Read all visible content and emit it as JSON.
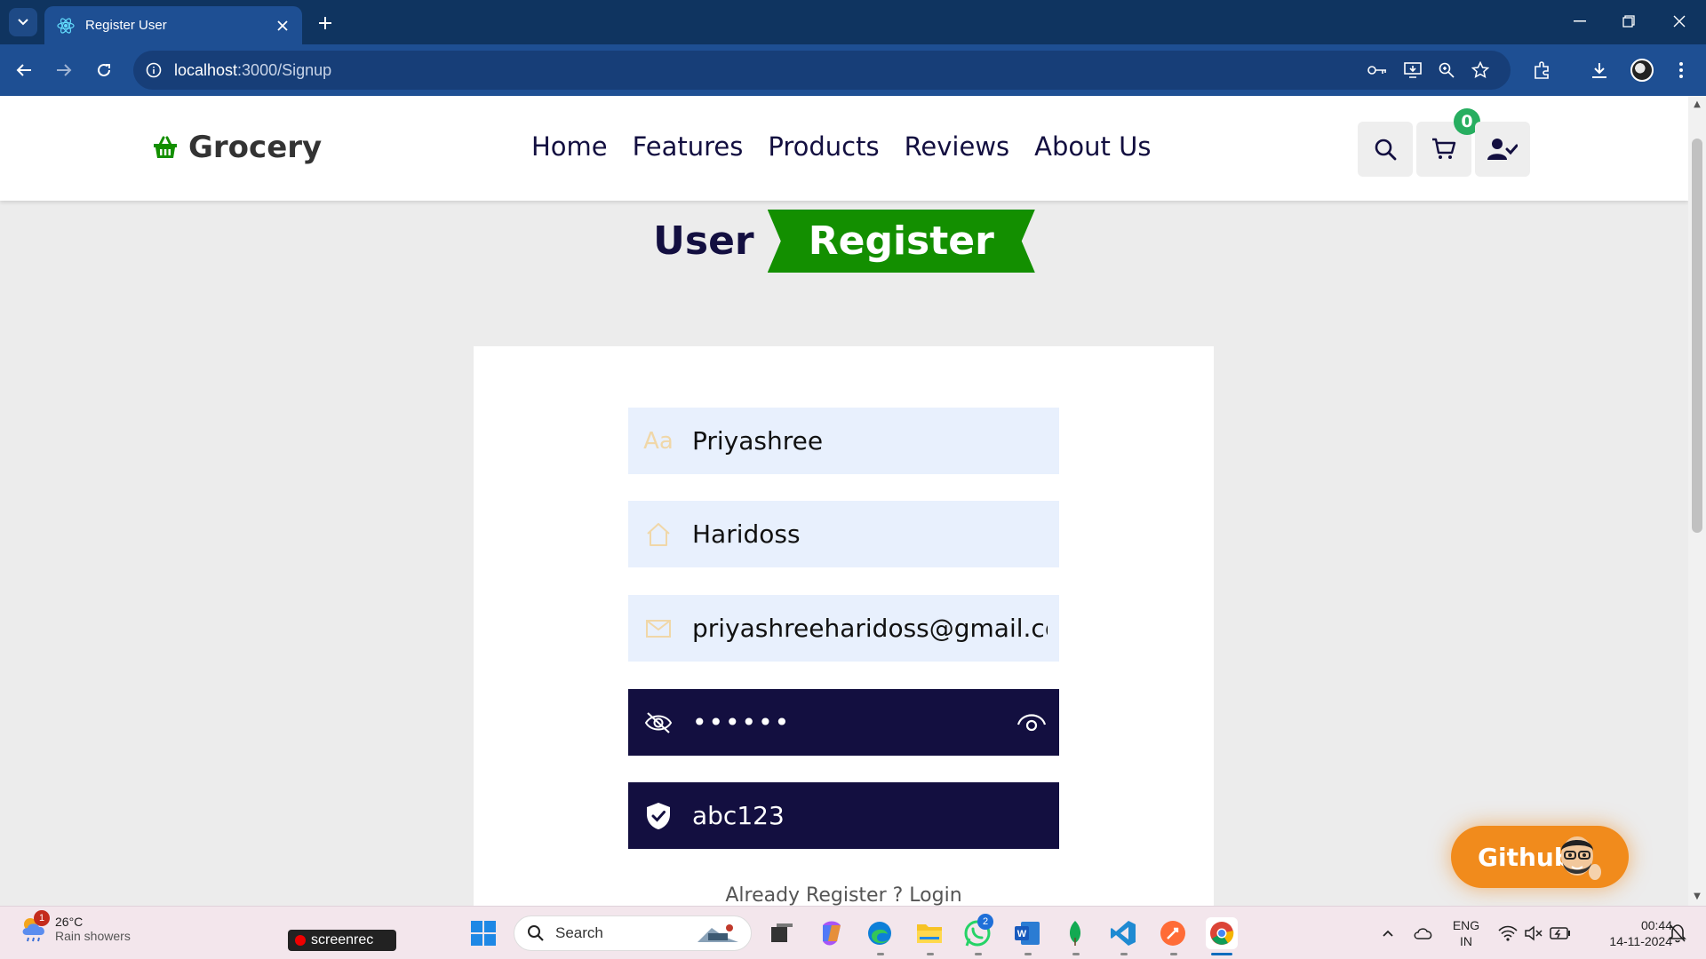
{
  "browser": {
    "tab_title": "Register User",
    "url_host": "localhost",
    "url_path": ":3000/Signup"
  },
  "site": {
    "logo_text": "Grocery",
    "nav": [
      "Home",
      "Features",
      "Products",
      "Reviews",
      "About Us"
    ],
    "cart_count": "0"
  },
  "heading": {
    "user_word": "User",
    "register_word": "Register"
  },
  "form": {
    "first_name": "Priyashree",
    "last_name": "Haridoss",
    "email": "priyashreeharidoss@gmail.com",
    "password_masked": "••••••",
    "captcha": "abc123",
    "login_link": "Already Register ? Login"
  },
  "github_button": "Github",
  "taskbar": {
    "weather_temp": "26°C",
    "weather_desc": "Rain showers",
    "weather_badge": "1",
    "screenrec": "screenrec",
    "search_placeholder": "Search",
    "whatsapp_badge": "2",
    "lang_top": "ENG",
    "lang_bottom": "IN",
    "time": "00:44",
    "date": "14-11-2024"
  },
  "colors": {
    "brand_green": "#138f00",
    "dark_navy": "#130f40",
    "browser_blue": "#1e4f93",
    "github_orange": "#f18b1c"
  }
}
